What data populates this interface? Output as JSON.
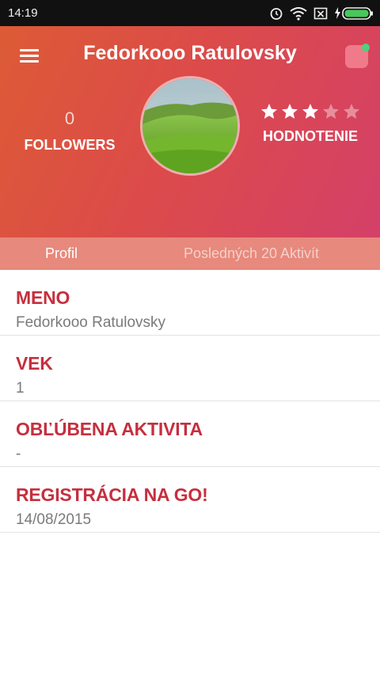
{
  "status_bar": {
    "time": "14:19"
  },
  "header": {
    "title": "Fedorkooo Ratulovsky",
    "followers": {
      "count": "0",
      "label": "FOLLOWERS"
    },
    "rating": {
      "value": 3,
      "max": 5,
      "label": "HODNOTENIE"
    }
  },
  "tabs": [
    {
      "label": "Profil",
      "active": true
    },
    {
      "label": "Posledných 20 Aktivít",
      "active": false
    }
  ],
  "fields": [
    {
      "label": "MENO",
      "value": "Fedorkooo Ratulovsky"
    },
    {
      "label": "VEK",
      "value": "1"
    },
    {
      "label": "OBĽÚBENA AKTIVITA",
      "value": "-"
    },
    {
      "label": "REGISTRÁCIA NA GO!",
      "value": "14/08/2015"
    }
  ],
  "colors": {
    "header_start": "#dd5b36",
    "header_end": "#d44068",
    "tab_bar": "#e7897c",
    "field_label": "#c62f3e",
    "notification_dot": "#4fd07a"
  }
}
